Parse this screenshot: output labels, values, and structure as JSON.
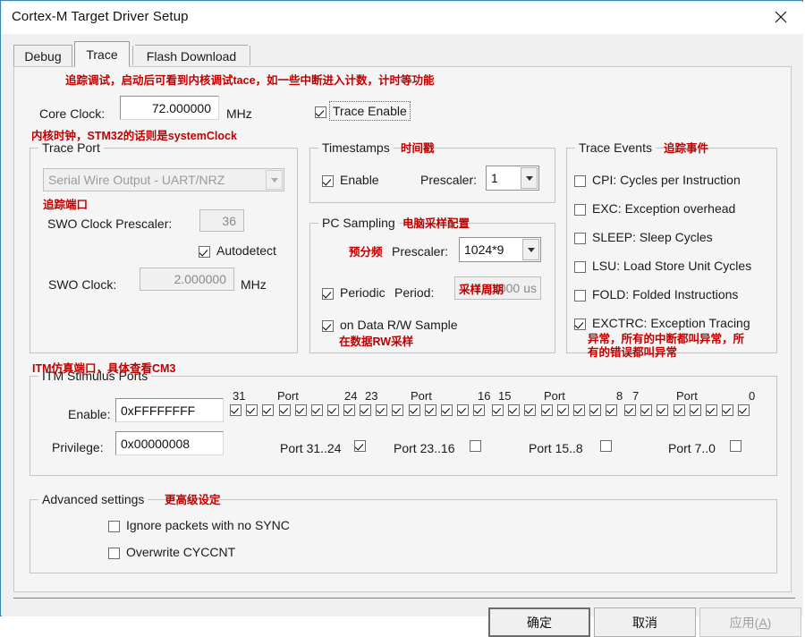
{
  "window": {
    "title": "Cortex-M Target Driver Setup",
    "close_icon": "close-icon"
  },
  "tabs": [
    {
      "label": "Debug",
      "selected": false
    },
    {
      "label": "Trace",
      "selected": true
    },
    {
      "label": "Flash Download",
      "selected": false
    }
  ],
  "annotations": {
    "trace_intro": "追踪调试，启动后可看到内核调试tace，如一些中断进入计数，计时等功能",
    "core_clock": "内核时钟，STM32的话则是systemClock",
    "trace_port": "追踪端口",
    "itm_ports": "ITM仿真端口，具体查看CM3",
    "timestamps": "时间戳",
    "pc_sampling": "电脑采样配置",
    "prescaler": "预分频",
    "period": "采样周期",
    "data_rw": "在数据RW采样",
    "trace_events": "追踪事件",
    "exctrc_line1": "异常，所有的中断都叫异常，所",
    "exctrc_line2": "有的错误都叫异常",
    "advanced": "更高级设定"
  },
  "core_clock": {
    "label": "Core Clock:",
    "value": "72.000000",
    "unit": "MHz"
  },
  "trace_enable": {
    "label": "Trace Enable",
    "checked": true
  },
  "trace_port": {
    "title": "Trace Port",
    "port_select": "Serial Wire Output - UART/NRZ",
    "swo_prescaler_label": "SWO Clock Prescaler:",
    "swo_prescaler_value": "36",
    "autodetect_label": "Autodetect",
    "autodetect_checked": true,
    "swo_clock_label": "SWO Clock:",
    "swo_clock_value": "2.000000",
    "swo_clock_unit": "MHz"
  },
  "timestamps": {
    "title": "Timestamps",
    "enable_label": "Enable",
    "enable_checked": true,
    "prescaler_label": "Prescaler:",
    "prescaler_value": "1"
  },
  "pc_sampling": {
    "title": "PC Sampling",
    "prescaler_label": "Prescaler:",
    "prescaler_value": "1024*9",
    "periodic_label": "Periodic",
    "periodic_checked": true,
    "period_label": "Period:",
    "period_value": "128.000",
    "period_unit": "us",
    "data_rw_label": "on Data R/W Sample",
    "data_rw_checked": true
  },
  "trace_events": {
    "title": "Trace Events",
    "items": [
      {
        "label": "CPI: Cycles per Instruction",
        "checked": false
      },
      {
        "label": "EXC: Exception overhead",
        "checked": false
      },
      {
        "label": "SLEEP: Sleep Cycles",
        "checked": false
      },
      {
        "label": "LSU: Load Store Unit Cycles",
        "checked": false
      },
      {
        "label": "FOLD: Folded Instructions",
        "checked": false
      },
      {
        "label": "EXCTRC: Exception Tracing",
        "checked": true
      }
    ]
  },
  "itm": {
    "title": "ITM Stimulus Ports",
    "enable_label": "Enable:",
    "enable_value": "0xFFFFFFFF",
    "privilege_label": "Privilege:",
    "privilege_value": "0x00000008",
    "scale_markers": [
      "31",
      "Port",
      "24",
      "23",
      "Port",
      "16",
      "15",
      "Port",
      "8",
      "7",
      "Port",
      "0"
    ],
    "port_bits_checked": [
      true,
      true,
      true,
      true,
      true,
      true,
      true,
      true,
      true,
      true,
      true,
      true,
      true,
      true,
      true,
      true,
      true,
      true,
      true,
      true,
      true,
      true,
      true,
      true,
      true,
      true,
      true,
      true,
      true,
      true,
      true,
      true
    ],
    "groups": [
      {
        "label": "Port 31..24",
        "checked": true
      },
      {
        "label": "Port 23..16",
        "checked": false
      },
      {
        "label": "Port 15..8",
        "checked": false
      },
      {
        "label": "Port 7..0",
        "checked": false
      }
    ]
  },
  "advanced": {
    "title": "Advanced settings",
    "items": [
      {
        "label": "Ignore packets with no SYNC",
        "checked": false
      },
      {
        "label": "Overwrite CYCCNT",
        "checked": false
      }
    ]
  },
  "buttons": {
    "ok": "确定",
    "cancel": "取消",
    "apply_pre": "应用(",
    "apply_key": "A",
    "apply_post": ")"
  },
  "colors": {
    "annotation": "#c00000",
    "dialog_border": "#3a86b8",
    "panel_bg": "#f5f5f5"
  }
}
